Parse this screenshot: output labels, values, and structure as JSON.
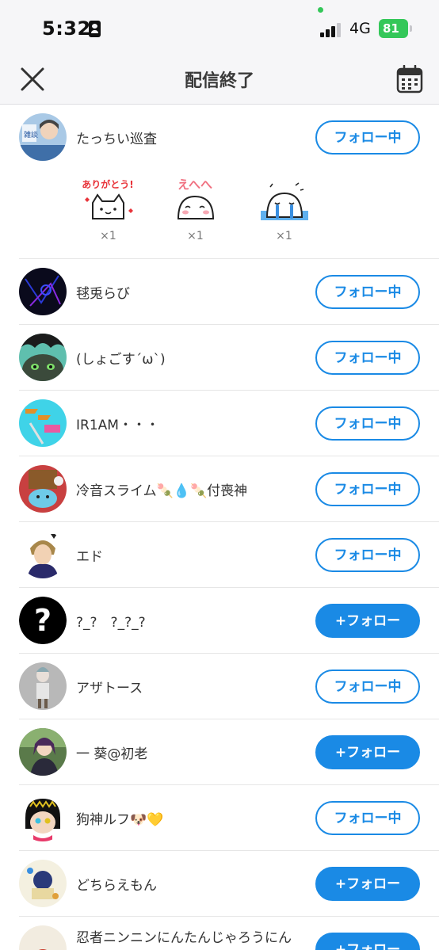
{
  "status_bar": {
    "time": "5:32",
    "network": "4G",
    "battery": "81"
  },
  "header": {
    "title": "配信終了"
  },
  "users": [
    {
      "name": "たっちい巡査",
      "button": "フォロー中",
      "state": "following",
      "stickers": [
        {
          "text": "ありがとう!",
          "count": "×1",
          "color": "#e8343a"
        },
        {
          "text": "えへへ",
          "count": "×1",
          "color": "#f07080"
        },
        {
          "text": "",
          "count": "×1",
          "color": "#3a8fe0"
        }
      ]
    },
    {
      "name": "毬兎らび",
      "button": "フォロー中",
      "state": "following"
    },
    {
      "name": "(しょごす´ω`)",
      "button": "フォロー中",
      "state": "following"
    },
    {
      "name": "IR1AM・・・",
      "button": "フォロー中",
      "state": "following"
    },
    {
      "name": "冷音スライム🍡💧🍡付喪神",
      "button": "フォロー中",
      "state": "following"
    },
    {
      "name": "エド",
      "button": "フォロー中",
      "state": "following"
    },
    {
      "name": "?_?　?_?_?",
      "button": "+フォロー",
      "state": "follow"
    },
    {
      "name": "アザトース",
      "button": "フォロー中",
      "state": "following"
    },
    {
      "name": "一 葵@初老",
      "button": "+フォロー",
      "state": "follow"
    },
    {
      "name": "狗神ルフ🐶💛",
      "button": "フォロー中",
      "state": "following"
    },
    {
      "name": "どちらえもん",
      "button": "+フォロー",
      "state": "follow"
    },
    {
      "name": "忍者ニンニンにんたんじゃろうにん",
      "button": "+フォロー",
      "state": "follow"
    }
  ],
  "colors": {
    "accent": "#1a8ae5",
    "header_bg": "#f6f6f8"
  }
}
